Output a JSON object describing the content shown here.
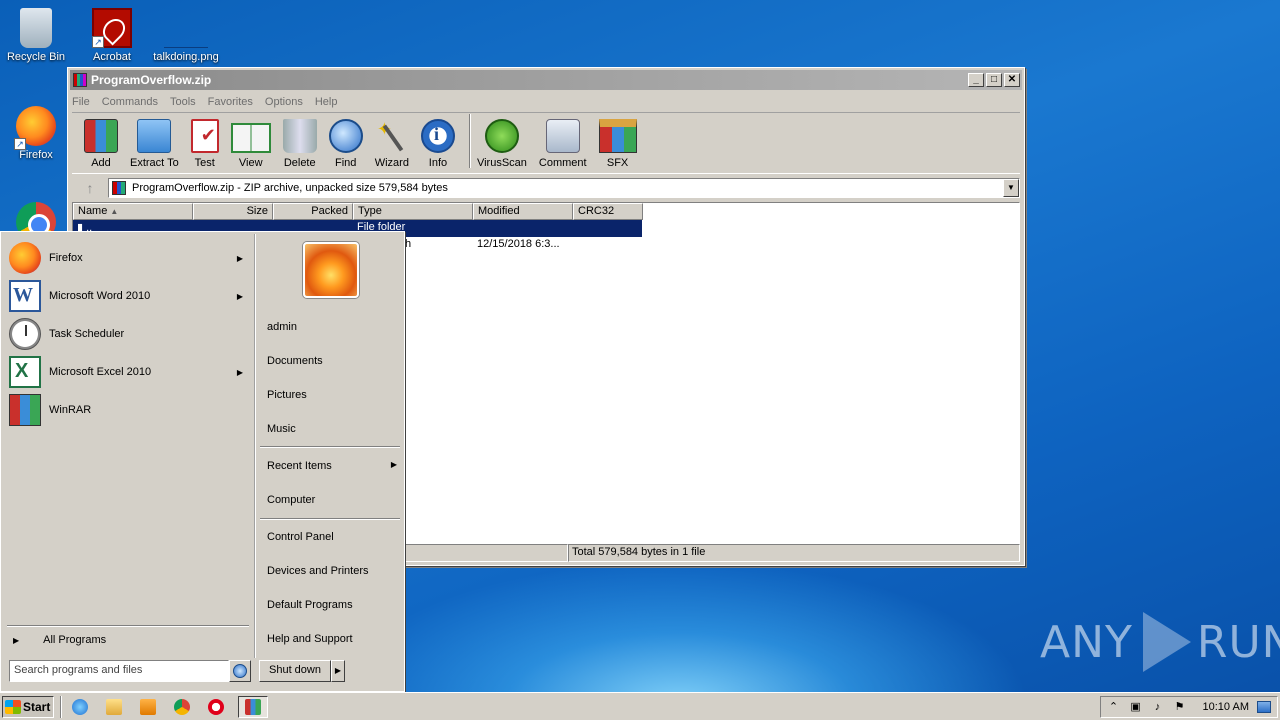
{
  "desktop": {
    "icons": [
      {
        "label": "Recycle Bin"
      },
      {
        "label": "Acrobat"
      },
      {
        "label": "talkdoing.png"
      },
      {
        "label": "Firefox"
      }
    ],
    "watermark": {
      "left": "ANY",
      "right": "RUN"
    }
  },
  "winrar": {
    "title": "ProgramOverflow.zip",
    "title_buttons": [
      "_",
      "□",
      "✕"
    ],
    "menu": [
      "File",
      "Commands",
      "Tools",
      "Favorites",
      "Options",
      "Help"
    ],
    "toolbar": [
      {
        "label": "Add",
        "icon": "add-icon"
      },
      {
        "label": "Extract To",
        "icon": "extract-icon"
      },
      {
        "label": "Test",
        "icon": "test-icon"
      },
      {
        "label": "View",
        "icon": "view-icon"
      },
      {
        "label": "Delete",
        "icon": "delete-icon"
      },
      {
        "label": "Find",
        "icon": "find-icon"
      },
      {
        "label": "Wizard",
        "icon": "wizard-icon"
      },
      {
        "label": "Info",
        "icon": "info-icon"
      },
      {
        "label": "VirusScan",
        "icon": "virusscan-icon"
      },
      {
        "label": "Comment",
        "icon": "comment-icon"
      },
      {
        "label": "SFX",
        "icon": "sfx-icon"
      }
    ],
    "address": "ProgramOverflow.zip - ZIP archive, unpacked size 579,584 bytes",
    "columns": [
      "Name",
      "Size",
      "Packed",
      "Type",
      "Modified",
      "CRC32"
    ],
    "rows": [
      {
        "type": "File folder"
      },
      {
        "type": "h",
        "modified": "12/15/2018 6:3..."
      }
    ],
    "status_right": "Total 579,584 bytes in 1 file"
  },
  "startmenu": {
    "programs": [
      {
        "label": "Firefox",
        "has_arrow": true
      },
      {
        "label": "Microsoft Word 2010",
        "has_arrow": true
      },
      {
        "label": "Task Scheduler",
        "has_arrow": false
      },
      {
        "label": "Microsoft Excel 2010",
        "has_arrow": true
      },
      {
        "label": "WinRAR",
        "has_arrow": false
      }
    ],
    "all_programs": "All Programs",
    "search_placeholder": "Search programs and files",
    "right_links": [
      "admin",
      "Documents",
      "Pictures",
      "Music",
      "Recent Items",
      "Computer",
      "Control Panel",
      "Devices and Printers",
      "Default Programs",
      "Help and Support"
    ],
    "shutdown": "Shut down"
  },
  "taskbar": {
    "start_label": "Start",
    "clock": "10:10 AM"
  }
}
